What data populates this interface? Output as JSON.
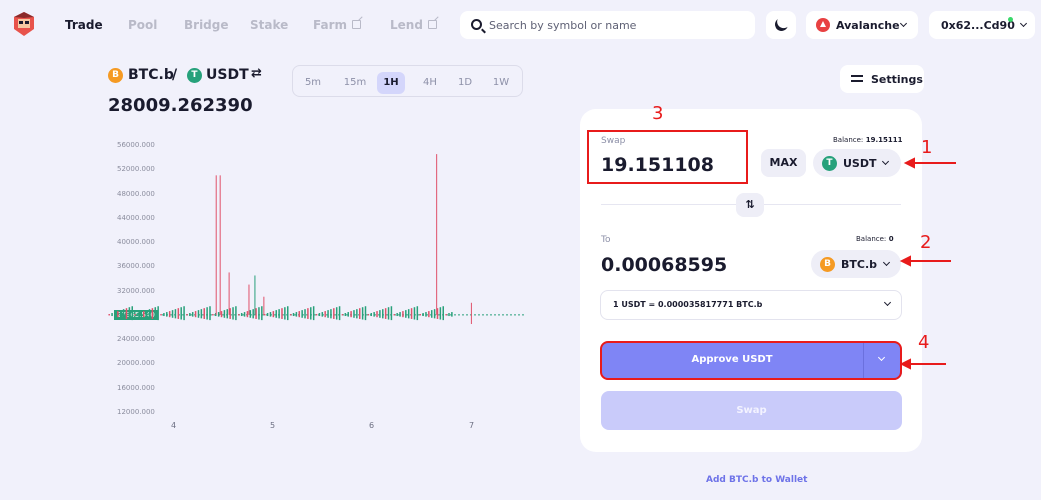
{
  "nav": {
    "links": [
      {
        "label": "Trade",
        "active": true
      },
      {
        "label": "Pool",
        "active": false
      },
      {
        "label": "Bridge",
        "active": false
      },
      {
        "label": "Stake",
        "active": false
      },
      {
        "label": "Farm",
        "active": false,
        "external": true
      },
      {
        "label": "Lend",
        "active": false,
        "external": true
      }
    ],
    "search_placeholder": "Search by symbol or name",
    "network": "Avalanche",
    "wallet": "0x62...Cd90"
  },
  "pair": {
    "base": "BTC.b",
    "separator": "/",
    "quote": "USDT",
    "price": "28009.262390"
  },
  "timeframes": [
    "5m",
    "15m",
    "1H",
    "4H",
    "1D",
    "1W"
  ],
  "selected_timeframe": "1H",
  "settings_label": "Settings",
  "swap": {
    "from_label": "Swap",
    "from_balance_label": "Balance:",
    "from_balance": "19.15111",
    "from_amount": "19.151108",
    "max_label": "MAX",
    "from_token": "USDT",
    "to_label": "To",
    "to_balance_label": "Balance:",
    "to_balance": "0",
    "to_amount": "0.00068595",
    "to_token": "BTC.b",
    "rate": "1 USDT = 0.000035817771 BTC.b",
    "approve_label": "Approve USDT",
    "swap_label": "Swap",
    "add_wallet_label": "Add BTC.b to Wallet"
  },
  "annotations": [
    "1",
    "2",
    "3",
    "4"
  ],
  "chart_data": {
    "type": "candlestick",
    "y_ticks": [
      "56000.000",
      "52000.000",
      "48000.000",
      "44000.000",
      "40000.000",
      "36000.000",
      "32000.000",
      "24000.000",
      "20000.000",
      "16000.000",
      "12000.000"
    ],
    "x_ticks": [
      "4",
      "5",
      "6",
      "7"
    ],
    "current_price_label": "27965.540",
    "ylim": [
      12000,
      58000
    ],
    "spikes": [
      {
        "x": 3.1,
        "high": 34000,
        "low": 16000,
        "color": "#28a07a"
      },
      {
        "x": 4.42,
        "high": 51000,
        "low": 28000,
        "color": "#e0516a"
      },
      {
        "x": 4.46,
        "high": 51000,
        "low": 28000,
        "color": "#e0516a"
      },
      {
        "x": 4.55,
        "high": 35000,
        "low": 28000,
        "color": "#e0516a"
      },
      {
        "x": 4.75,
        "high": 33000,
        "low": 28000,
        "color": "#e0516a"
      },
      {
        "x": 4.81,
        "high": 34500,
        "low": 28000,
        "color": "#28a07a"
      },
      {
        "x": 4.9,
        "high": 31000,
        "low": 28000,
        "color": "#e0516a"
      },
      {
        "x": 6.64,
        "high": 54500,
        "low": 28000,
        "color": "#e0516a"
      },
      {
        "x": 6.99,
        "high": 30000,
        "low": 26500,
        "color": "#e0516a"
      }
    ]
  }
}
